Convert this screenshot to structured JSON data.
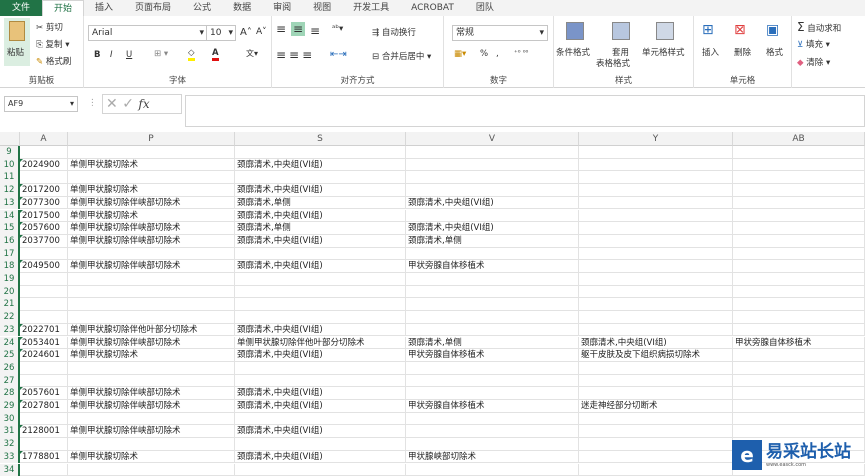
{
  "tabs": [
    "文件",
    "开始",
    "插入",
    "页面布局",
    "公式",
    "数据",
    "审阅",
    "视图",
    "开发工具",
    "ACROBAT",
    "团队"
  ],
  "ribbon": {
    "clipboard": {
      "paste": "粘贴",
      "cut": "剪切",
      "copy": "复制",
      "format_painter": "格式刷",
      "label": "剪贴板"
    },
    "font": {
      "name": "Arial",
      "size": "10",
      "grow": "A",
      "shrink": "A",
      "bold": "B",
      "italic": "I",
      "underline": "U",
      "label": "字体"
    },
    "alignment": {
      "wrap": "自动换行",
      "merge": "合并后居中",
      "label": "对齐方式"
    },
    "number": {
      "format": "常规",
      "percent": "%",
      "comma": ",",
      "label": "数字"
    },
    "styles": {
      "conditional": "条件格式",
      "table": "套用",
      "table2": "表格格式",
      "cell_styles": "单元格样式",
      "label": "样式"
    },
    "cells": {
      "insert": "插入",
      "delete": "删除",
      "format": "格式",
      "label": "单元格"
    },
    "editing": {
      "autosum": "自动求和",
      "fill": "填充",
      "clear": "清除"
    }
  },
  "formula_bar": {
    "name_box": "AF9",
    "fx": "fx",
    "value": ""
  },
  "columns": [
    "A",
    "P",
    "S",
    "V",
    "Y",
    "AB"
  ],
  "rows": [
    {
      "n": "9"
    },
    {
      "n": "10",
      "A": "2024900",
      "P": "单侧甲状腺切除术",
      "S": "颈廓清术,中央组(VI组)"
    },
    {
      "n": "11"
    },
    {
      "n": "12",
      "A": "2017200",
      "P": "单侧甲状腺切除术",
      "S": "颈廓清术,中央组(VI组)"
    },
    {
      "n": "13",
      "A": "2077300",
      "P": "单侧甲状腺切除伴峡部切除术",
      "S": "颈廓清术,单侧",
      "V": "颈廓清术,中央组(VI组)"
    },
    {
      "n": "14",
      "A": "2017500",
      "P": "单侧甲状腺切除术",
      "S": "颈廓清术,中央组(VI组)"
    },
    {
      "n": "15",
      "A": "2057600",
      "P": "单侧甲状腺切除伴峡部切除术",
      "S": "颈廓清术,单侧",
      "V": "颈廓清术,中央组(VI组)"
    },
    {
      "n": "16",
      "A": "2037700",
      "P": "单侧甲状腺切除伴峡部切除术",
      "S": "颈廓清术,中央组(VI组)",
      "V": "颈廓清术,单侧"
    },
    {
      "n": "17"
    },
    {
      "n": "18",
      "A": "2049500",
      "P": "单侧甲状腺切除伴峡部切除术",
      "S": "颈廓清术,中央组(VI组)",
      "V": "甲状旁腺自体移植术"
    },
    {
      "n": "19"
    },
    {
      "n": "20"
    },
    {
      "n": "21"
    },
    {
      "n": "22"
    },
    {
      "n": "23",
      "A": "2022701",
      "P": "单侧甲状腺切除伴他叶部分切除术",
      "S": "颈廓清术,中央组(VI组)"
    },
    {
      "n": "24",
      "A": "2053401",
      "P": "单侧甲状腺切除伴峡部切除术",
      "S": "单侧甲状腺切除伴他叶部分切除术",
      "V": "颈廓清术,单侧",
      "Y": "颈廓清术,中央组(VI组)",
      "AB": "甲状旁腺自体移植术"
    },
    {
      "n": "25",
      "A": "2024601",
      "P": "单侧甲状腺切除术",
      "S": "颈廓清术,中央组(VI组)",
      "V": "甲状旁腺自体移植术",
      "Y": "躯干皮肤及皮下组织病损切除术"
    },
    {
      "n": "26"
    },
    {
      "n": "27"
    },
    {
      "n": "28",
      "A": "2057601",
      "P": "单侧甲状腺切除伴峡部切除术",
      "S": "颈廓清术,中央组(VI组)"
    },
    {
      "n": "29",
      "A": "2027801",
      "P": "单侧甲状腺切除伴峡部切除术",
      "S": "颈廓清术,中央组(VI组)",
      "V": "甲状旁腺自体移植术",
      "Y": "迷走神经部分切断术"
    },
    {
      "n": "30"
    },
    {
      "n": "31",
      "A": "2128001",
      "P": "单侧甲状腺切除伴峡部切除术",
      "S": "颈廓清术,中央组(VI组)"
    },
    {
      "n": "32"
    },
    {
      "n": "33",
      "A": "1778801",
      "P": "单侧甲状腺切除术",
      "S": "颈廓清术,中央组(VI组)",
      "V": "甲状腺峡部切除术"
    },
    {
      "n": "34"
    }
  ],
  "watermark": {
    "text": "易采站长站",
    "sub": "www.easck.com"
  },
  "colors": {
    "accent": "#217346"
  }
}
